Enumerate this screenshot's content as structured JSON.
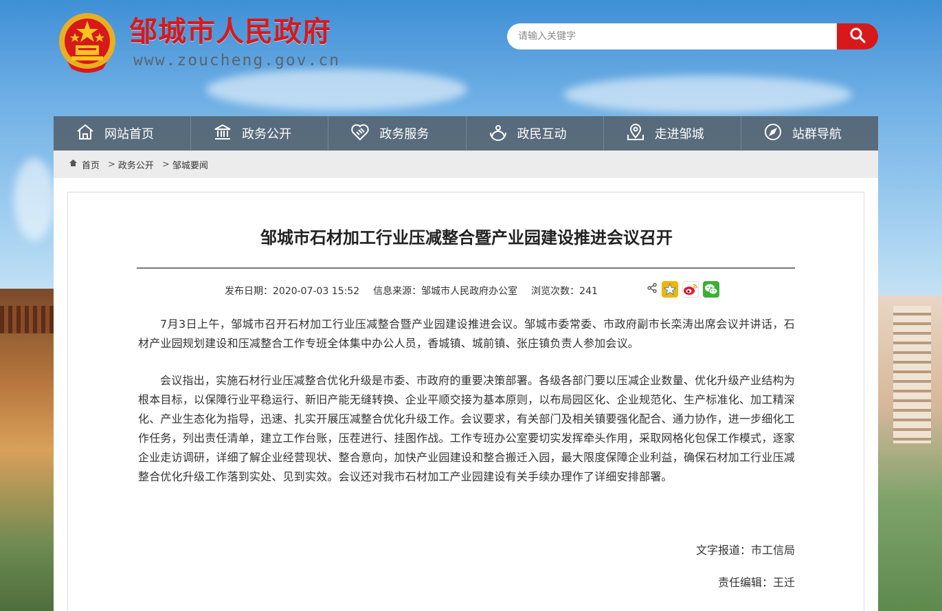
{
  "header": {
    "site_title": "邹城市人民政府",
    "site_url": "www.zoucheng.gov.cn",
    "emblem_icon": "national-emblem-icon",
    "brand_color": "#d7191b"
  },
  "search": {
    "placeholder": "请输入关键字",
    "button_icon": "search-icon"
  },
  "nav": {
    "items": [
      {
        "label": "网站首页",
        "icon": "home-icon"
      },
      {
        "label": "政务公开",
        "icon": "government-building-icon"
      },
      {
        "label": "政务服务",
        "icon": "handshake-icon"
      },
      {
        "label": "政民互动",
        "icon": "interaction-icon"
      },
      {
        "label": "走进邹城",
        "icon": "map-pin-icon"
      },
      {
        "label": "站群导航",
        "icon": "compass-icon"
      }
    ]
  },
  "breadcrumb": {
    "items": [
      "首页",
      "政务公开",
      "邹城要闻"
    ],
    "separator": ">"
  },
  "article": {
    "title": "邹城市石材加工行业压减整合暨产业园建设推进会议召开",
    "publish_date": "发布日期：2020-07-03 15:52",
    "source": "信息来源：邹城市人民政府办公室",
    "views": "浏览次数：241",
    "paragraphs": [
      "7月3日上午，邹城市召开石材加工行业压减整合暨产业园建设推进会议。邹城市委常委、市政府副市长栾涛出席会议并讲话，石材产业园规划建设和压减整合工作专班全体集中办公人员，香城镇、城前镇、张庄镇负责人参加会议。",
      "会议指出，实施石材行业压减整合优化升级是市委、市政府的重要决策部署。各级各部门要以压减企业数量、优化升级产业结构为根本目标，以保障行业平稳运行、新旧产能无缝转换、企业平顺交接为基本原则，以布局园区化、企业规范化、生产标准化、加工精深化、产业生态化为指导，迅速、扎实开展压减整合优化升级工作。会议要求，有关部门及相关镇要强化配合、通力协作，进一步细化工作任务，列出责任清单，建立工作台账，压茬进行、挂图作战。工作专班办公室要切实发挥牵头作用，采取网格化包保工作模式，逐家企业走访调研，详细了解企业经营现状、整合意向，加快产业园建设和整合搬迁入园，最大限度保障企业利益，确保石材加工行业压减整合优化升级工作落到实处、见到实效。会议还对我市石材加工产业园建设有关手续办理作了详细安排部署。"
    ],
    "reporter": "文字报道：市工信局",
    "editor": "责任编辑：王迁",
    "share_icons": [
      "share-icon",
      "qzone-icon",
      "weibo-icon",
      "wechat-icon"
    ]
  }
}
